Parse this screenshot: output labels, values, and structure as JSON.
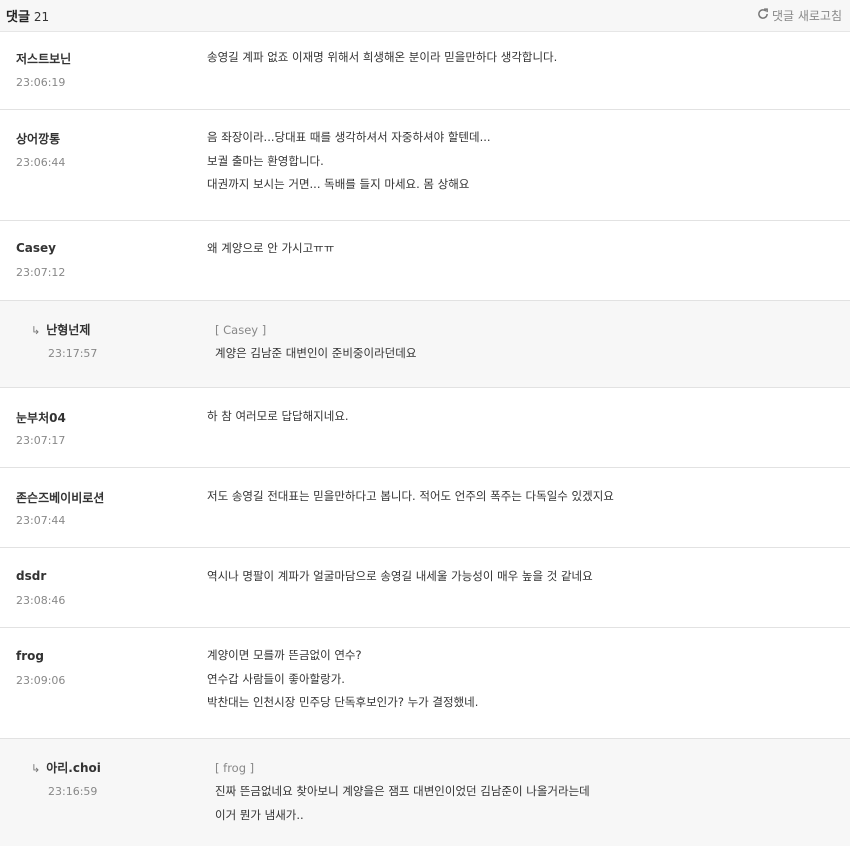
{
  "header": {
    "title": "댓글",
    "count": "21",
    "refresh_label": "댓글 새로고침"
  },
  "comments": [
    {
      "author": "저스트보닌",
      "time": "23:06:19",
      "lines": [
        "송영길 계파 없죠 이재명 위해서 희생해온 분이라 믿을만하다 생각합니다."
      ]
    },
    {
      "author": "상어깡통",
      "time": "23:06:44",
      "lines": [
        "음 좌장이라...당대표 때를 생각하셔서 자중하셔야 할텐데...",
        "보궐 출마는 환영합니다.",
        "대권까지 보시는 거면... 독배를 들지 마세요. 몸 상해요"
      ]
    },
    {
      "author": "Casey",
      "time": "23:07:12",
      "lines": [
        "왜 계양으로 안 가시고ㅠㅠ"
      ]
    },
    {
      "author": "난형넌제",
      "time": "23:17:57",
      "reply_arrow": "↳",
      "reply_to": "[ Casey ]",
      "lines": [
        "계양은 김남준 대변인이 준비중이라던데요"
      ]
    },
    {
      "author": "눈부처04",
      "time": "23:07:17",
      "lines": [
        "하 참 여러모로 답답해지네요."
      ]
    },
    {
      "author": "존슨즈베이비로션",
      "time": "23:07:44",
      "lines": [
        "저도 송영길 전대표는 믿을만하다고 봅니다. 적어도 언주의 폭주는 다독일수 있겠지요"
      ]
    },
    {
      "author": "dsdr",
      "time": "23:08:46",
      "lines": [
        "역시나 명팔이 계파가 얼굴마담으로 송영길 내세울 가능성이 매우 높을 것 같네요"
      ]
    },
    {
      "author": "frog",
      "time": "23:09:06",
      "lines": [
        "계양이면 모를까 뜬금없이 연수?",
        "연수갑 사람들이 좋아할랑가.",
        "박찬대는 인천시장 민주당 단독후보인가? 누가 결정했네."
      ]
    },
    {
      "author": "아리.choi",
      "time": "23:16:59",
      "reply_arrow": "↳",
      "reply_to": "[ frog ]",
      "lines": [
        "진짜 뜬금없네요 찾아보니 계양을은 잼프 대변인이었던 김남준이 나올거라는데",
        "이거 뭔가 냄새가.."
      ]
    }
  ]
}
